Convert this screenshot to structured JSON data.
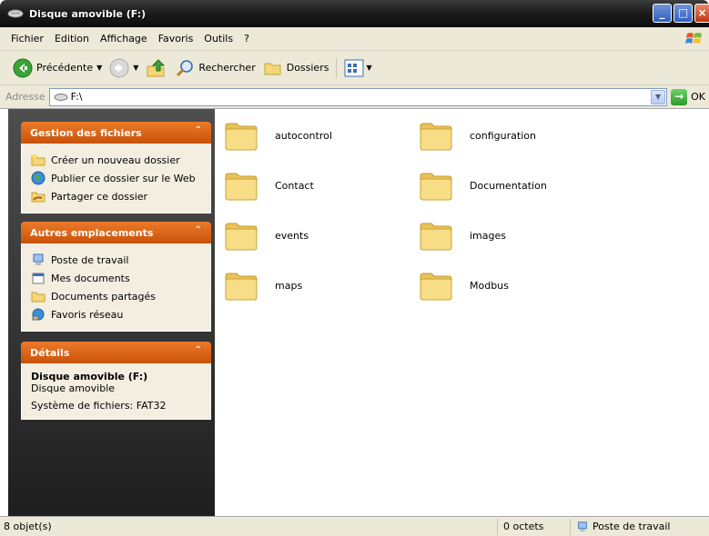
{
  "window": {
    "title": "Disque amovible (F:)",
    "controls": {
      "minimize": "_",
      "maximize": "□",
      "close": "×"
    }
  },
  "menubar": {
    "items": [
      "Fichier",
      "Edition",
      "Affichage",
      "Favoris",
      "Outils",
      "?"
    ]
  },
  "toolbar": {
    "back_label": "Précédente",
    "search_label": "Rechercher",
    "folders_label": "Dossiers"
  },
  "address": {
    "label": "Adresse",
    "value": "F:\\",
    "go_label": "OK"
  },
  "taskpane": {
    "file_tasks": {
      "title": "Gestion des fichiers",
      "items": [
        "Créer un nouveau dossier",
        "Publier ce dossier sur le Web",
        "Partager ce dossier"
      ]
    },
    "other_places": {
      "title": "Autres emplacements",
      "items": [
        "Poste de travail",
        "Mes documents",
        "Documents partagés",
        "Favoris réseau"
      ]
    },
    "details": {
      "title": "Détails",
      "name": "Disque amovible (F:)",
      "type": "Disque amovible",
      "filesystem": "Système de fichiers: FAT32"
    }
  },
  "files": [
    "autocontrol",
    "configuration",
    "Contact",
    "Documentation",
    "events",
    "images",
    "maps",
    "Modbus"
  ],
  "statusbar": {
    "count": "8 objet(s)",
    "size": "0 octets",
    "location": "Poste de travail"
  },
  "colors": {
    "panel_header": "#d9600f",
    "panel_body": "#f3eee0",
    "folder": "#f4d77a"
  }
}
